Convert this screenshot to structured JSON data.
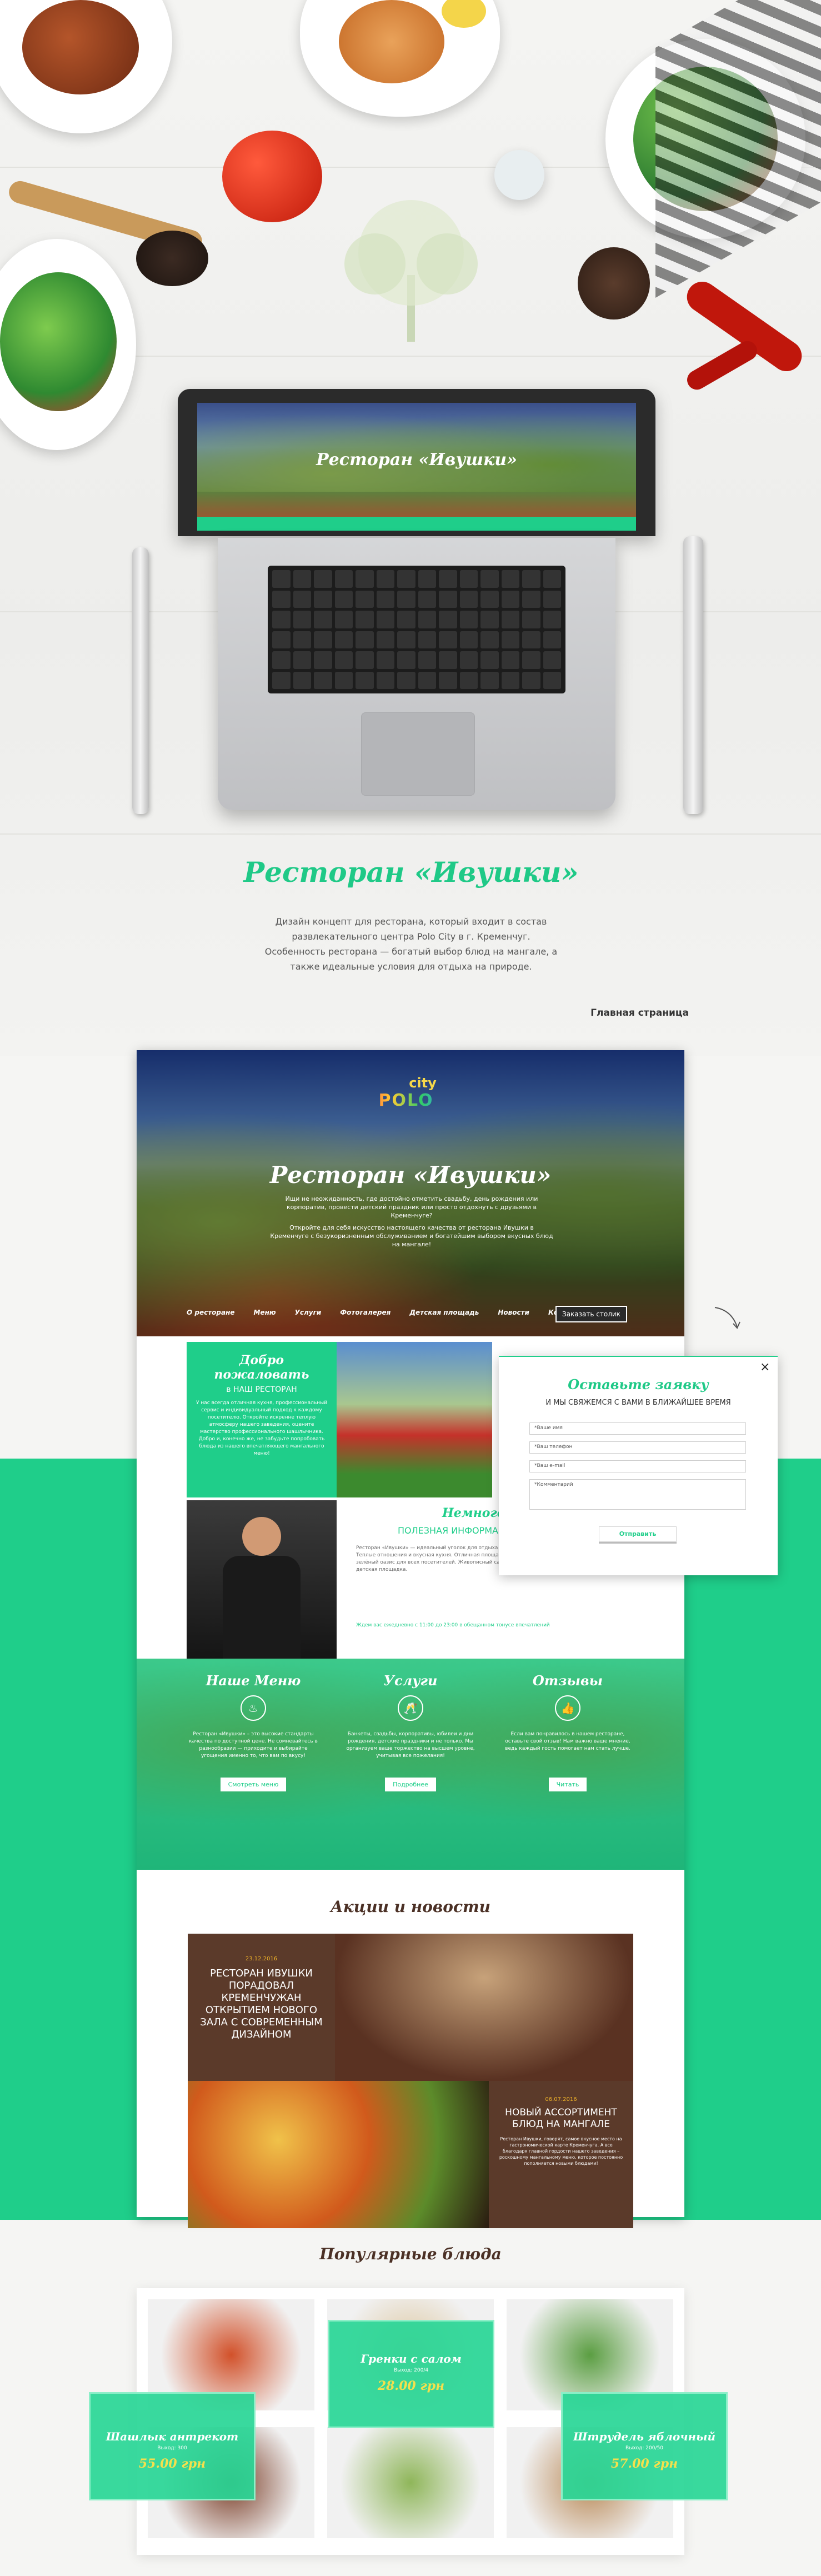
{
  "hero": {
    "title": "Ресторан «Ивушки»",
    "description": "Дизайн концепт для ресторана, который входит в состав развлекательного центра Polo City в г. Кременчуг. Особенность ресторана — богатый выбор блюд на мангале, а также идеальные условия для отдыха на природе.",
    "section_caption": "Главная страница"
  },
  "site": {
    "logo_top": "city",
    "logo_main": "POLO",
    "hero_title": "Ресторан «Ивушки»",
    "hero_lead": "Ищи не неожиданность, где достойно отметить свадьбу, день рождения или корпоратив, провести детский праздник или просто отдохнуть с друзьями в Кременчуге?",
    "hero_body": "Откройте для себя искусство настоящего качества от ресторана Ивушки в Кременчуге с безукоризненным обслуживанием и богатейшим выбором вкусных блюд на мангале!",
    "nav": [
      "О ресторане",
      "Меню",
      "Услуги",
      "Фотогалерея",
      "Детская площадь",
      "Новости",
      "Контакты"
    ],
    "nav_cta": "Заказать столик",
    "welcome_title": "Добро пожаловать",
    "welcome_sub": "в НАШ РЕСТОРАН",
    "welcome_text": "У нас всегда отличная кухня, профессиональный сервис и индивидуальный подход к каждому посетителю. Откройте искренне теплую атмосферу нашего заведения, оцените мастерство профессионального шашлычника. Добро и, конечно же, не забудьте попробовать блюда из нашего впечатляющего мангального меню!",
    "about_title": "Немного",
    "about_sub": "ПОЛЕЗНАЯ ИНФОРМАЦИЯ",
    "about_text": "Ресторан «Ивушки» — идеальный уголок для отдыха за чертой города, природой или при пикнике. Теплые отношения и вкусная кухня. Отличная площадка под открытым небом, уютная беседка и зелёный оазис для всех посетителей. Живописный сад с бассейном, мангальная зона, фонтаны, пруд, детская площадка.",
    "about_hours": "Ждем вас ежедневно с 11:00 до 23:00 в обещанном тонусе впечатлений",
    "form": {
      "title": "Оставьте заявку",
      "sub": "И МЫ СВЯЖЕМСЯ С ВАМИ В БЛИЖАЙШЕЕ ВРЕМЯ",
      "name_ph": "*Ваше имя",
      "phone_ph": "*Ваш телефон",
      "email_ph": "*Ваш e-mail",
      "comment_ph": "*Комментарий",
      "submit": "Отправить",
      "close": "×"
    },
    "features": [
      {
        "title": "Наше Меню",
        "icon": "chef-hat-icon",
        "text": "Ресторан «Ивушки» – это высокие стандарты качества по доступной цене. Не сомневайтесь в разнообразии — приходите и выбирайте угощения именно то, что вам по вкусу!",
        "cta": "Смотреть меню"
      },
      {
        "title": "Услуги",
        "icon": "champagne-icon",
        "text": "Банкеты, свадьбы, корпоративы, юбилеи и дни рождения, детские праздники и не только. Мы организуем ваше торжество на высшем уровне, учитывая все пожелания!",
        "cta": "Подробнее"
      },
      {
        "title": "Отзывы",
        "icon": "thumbs-up-icon",
        "text": "Если вам понравилось в нашем ресторане, оставьте свой отзыв! Нам важно ваше мнение, ведь каждый гость помогает нам стать лучше.",
        "cta": "Читать"
      }
    ],
    "news_title": "Акции и новости",
    "news": [
      {
        "date": "23.12.2016",
        "title": "РЕСТОРАН ИВУШКИ ПОРАДОВАЛ КРЕМЕНЧУЖАН ОТКРЫТИЕМ НОВОГО ЗАЛА С СОВРЕМЕННЫМ ДИЗАЙНОМ"
      },
      {
        "date": "06.07.2016",
        "title": "НОВЫЙ АССОРТИМЕНТ БЛЮД НА МАНГАЛЕ",
        "text": "Ресторан Ивушки, говорят, самое вкусное место на гастрономической карте Кременчуга. А все благодаря главной гордости нашего заведения – роскошному мангальному меню, которое постоянно пополняется новыми блюдами!"
      }
    ]
  },
  "popular": {
    "title": "Популярные блюда",
    "items": [
      {
        "name": "Шашлык антрекот",
        "weight": "Выход: 300",
        "price": "55.00 грн"
      },
      {
        "name": "Гренки с салом",
        "weight": "Выход: 200/4",
        "price": "28.00 грн"
      },
      {
        "name": "Штрудель яблочный",
        "weight": "Выход: 200/50",
        "price": "57.00 грн"
      }
    ]
  },
  "colors": {
    "accent": "#1fce8a",
    "brown": "#4b3025",
    "dark": "#2a2a2a"
  }
}
